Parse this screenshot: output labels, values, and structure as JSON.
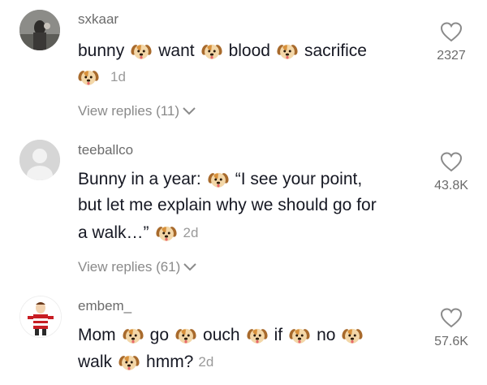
{
  "comments": [
    {
      "username": "sxkaar",
      "line1": [
        "bunny",
        "want",
        "blood",
        "sacrifice"
      ],
      "age": "1d",
      "view_replies": "View replies (11)",
      "likes": "2327"
    },
    {
      "username": "teeballco",
      "line1_a": "Bunny in a year:",
      "line1_b": "“I see your point,",
      "line2": "but let me explain why we should go for",
      "line3": "a walk…”",
      "age": "2d",
      "view_replies": "View replies (61)",
      "likes": "43.8K"
    },
    {
      "username": "embem_",
      "line1": [
        "Mom",
        "go",
        "ouch",
        "if",
        "no"
      ],
      "line2_a": "walk",
      "line2_b": "hmm?",
      "age": "2d",
      "likes": "57.6K"
    }
  ],
  "icons": {
    "emoji": "dog-face-icon",
    "heart": "heart-outline-icon",
    "chevron": "chevron-down-icon"
  }
}
